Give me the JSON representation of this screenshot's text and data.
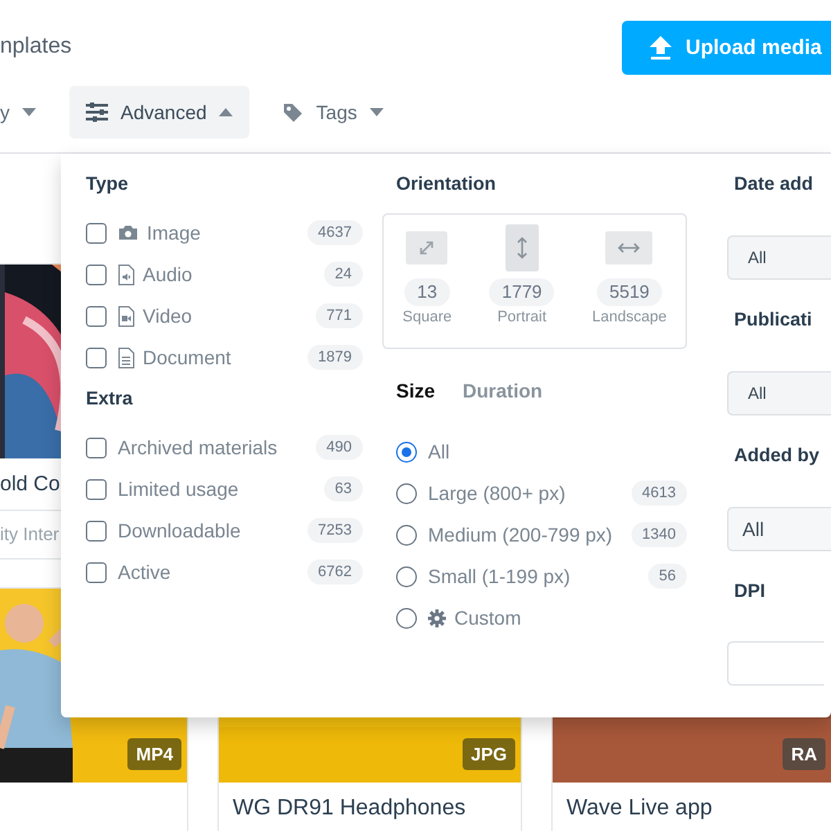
{
  "header": {
    "title": "nplates",
    "upload_button": "Upload media"
  },
  "filters": [
    {
      "label": "y",
      "kind": "plain",
      "expanded": false
    },
    {
      "label": "Advanced",
      "kind": "sliders",
      "expanded": true
    },
    {
      "label": "Tags",
      "kind": "tag",
      "expanded": false
    }
  ],
  "card_rows": [
    {
      "cards": [
        {
          "title": "old Co",
          "subtitle": "ity Inter",
          "kind": "phone"
        }
      ]
    },
    {
      "cards": [
        {
          "badge": "MP4",
          "kind": "person"
        },
        {
          "badge": "JPG",
          "title": "WG DR91 Headphones",
          "kind": "headphones"
        },
        {
          "badge": "RA",
          "title": "Wave Live app",
          "kind": "laptop"
        }
      ]
    }
  ],
  "advanced_panel": {
    "type": {
      "heading": "Type",
      "items": [
        {
          "label": "Image",
          "count": "4637",
          "checked": false
        },
        {
          "label": "Audio",
          "kind": "audio",
          "count": "24",
          "checked": false
        },
        {
          "label": "Video",
          "kind": "video",
          "count": "771",
          "checked": false
        },
        {
          "label": "Document",
          "kind": "document",
          "count": "1879",
          "checked": false
        }
      ]
    },
    "extra": {
      "heading": "Extra",
      "items": [
        {
          "label": "Archived materials",
          "count": "490",
          "checked": false
        },
        {
          "label": "Limited usage",
          "count": "63",
          "checked": false
        },
        {
          "label": "Downloadable",
          "count": "7253",
          "checked": false
        },
        {
          "label": "Active",
          "count": "6762",
          "checked": false
        }
      ]
    },
    "orientation": {
      "heading": "Orientation",
      "options": [
        {
          "kind": "square",
          "count": "13",
          "label": "Square",
          "selected": false
        },
        {
          "kind": "portrait",
          "count": "1779",
          "label": "Portrait",
          "selected": true
        },
        {
          "kind": "landscape",
          "count": "5519",
          "label": "Landscape",
          "selected": false
        }
      ]
    },
    "tabs": [
      {
        "label": "Size",
        "selected": true
      },
      {
        "label": "Duration",
        "selected": false
      }
    ],
    "size_options": [
      {
        "label": "All",
        "kind": "preset",
        "selected": true
      },
      {
        "label": "Large (800+ px)",
        "kind": "preset",
        "count": "4613",
        "selected": false
      },
      {
        "label": "Medium (200-799 px)",
        "kind": "preset",
        "count": "1340",
        "selected": false
      },
      {
        "label": "Small (1-199 px)",
        "kind": "preset",
        "count": "56",
        "selected": false
      },
      {
        "label": "Custom",
        "kind": "custom",
        "selected": false
      }
    ],
    "fields": [
      {
        "label": "Date add",
        "kind": "select",
        "value": "All"
      },
      {
        "label": "Publicati",
        "kind": "select",
        "value": "All"
      },
      {
        "label": "Added by",
        "kind": "dropdown",
        "value": "All"
      },
      {
        "label": "DPI",
        "kind": "input"
      }
    ]
  }
}
